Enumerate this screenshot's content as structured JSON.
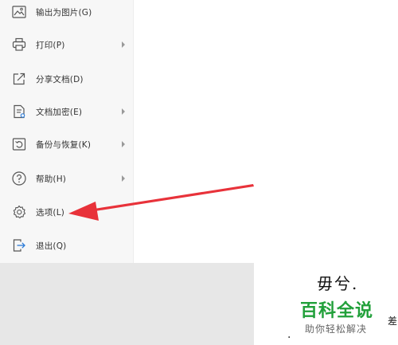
{
  "menu": {
    "items": [
      {
        "label": "输出为图片(G)",
        "icon": "image-export-icon",
        "submenu": false
      },
      {
        "label": "打印(P)",
        "icon": "printer-icon",
        "submenu": true
      },
      {
        "label": "分享文档(D)",
        "icon": "share-icon",
        "submenu": false
      },
      {
        "label": "文档加密(E)",
        "icon": "document-lock-icon",
        "submenu": true
      },
      {
        "label": "备份与恢复(K)",
        "icon": "backup-restore-icon",
        "submenu": true
      },
      {
        "label": "帮助(H)",
        "icon": "help-icon",
        "submenu": true
      },
      {
        "label": "选项(L)",
        "icon": "gear-icon",
        "submenu": false
      },
      {
        "label": "退出(Q)",
        "icon": "exit-icon",
        "submenu": false
      }
    ]
  },
  "document": {
    "visible_text": "毋兮.",
    "edge_char": "差",
    "dot": "."
  },
  "watermark": {
    "title": "百科全说",
    "subtitle": "助你轻松解决",
    "color": "#21a03a"
  },
  "annotation": {
    "arrow_color": "#e8323a",
    "points_to": "选项(L)"
  }
}
